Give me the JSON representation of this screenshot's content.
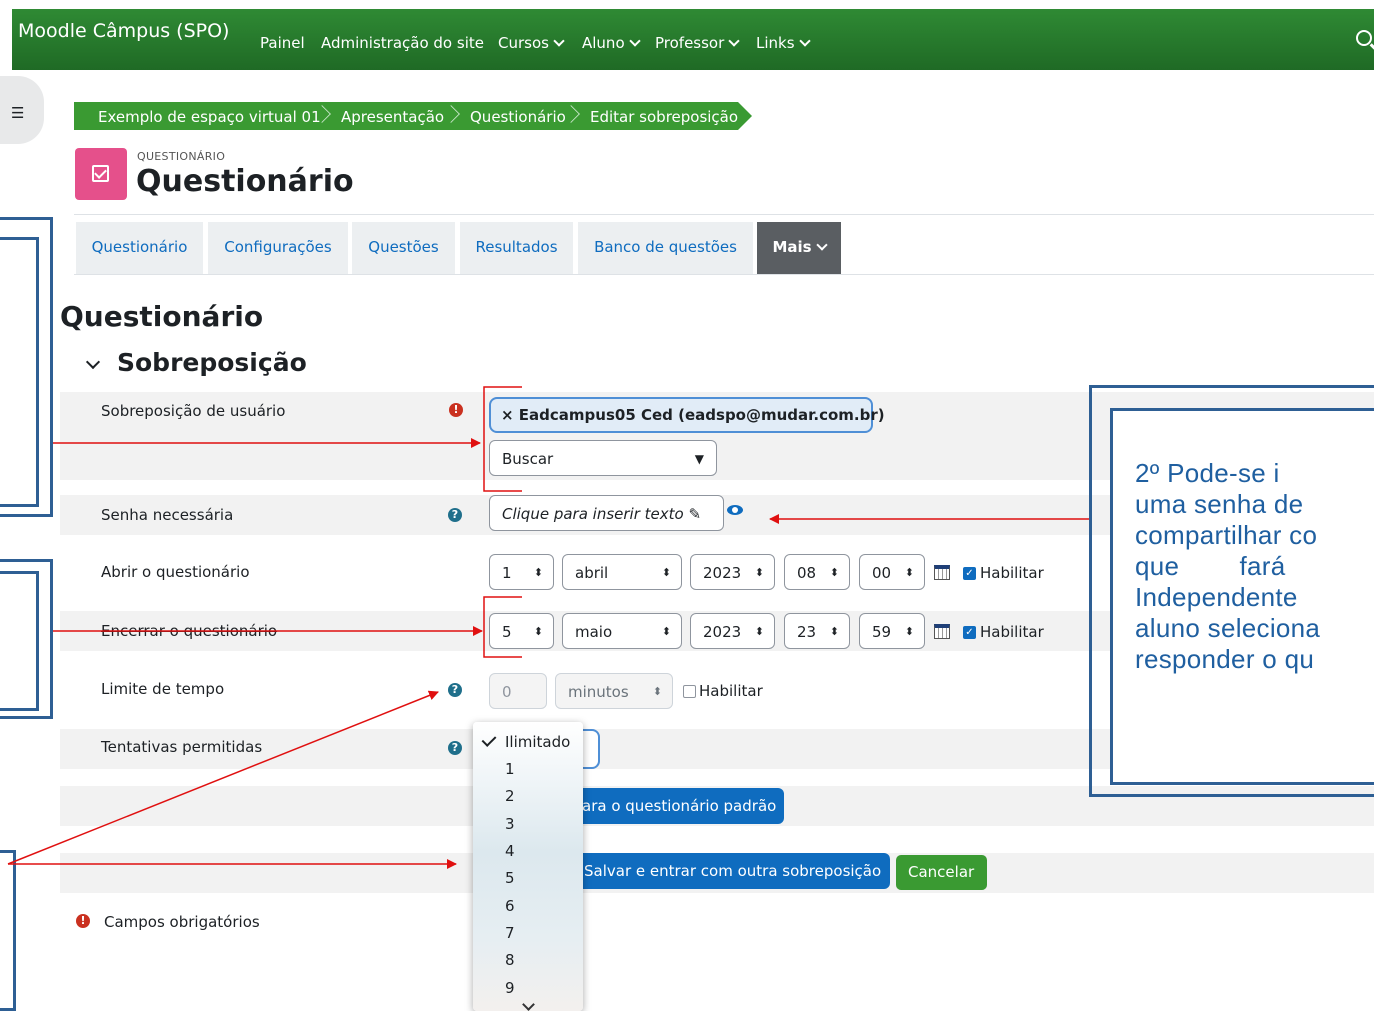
{
  "navbar": {
    "brand": "Moodle Câmpus (SPO)",
    "items": [
      {
        "label": "Painel"
      },
      {
        "label": "Administração do site"
      },
      {
        "label": "Cursos"
      },
      {
        "label": "Aluno"
      },
      {
        "label": "Professor"
      },
      {
        "label": "Links"
      }
    ]
  },
  "breadcrumb": [
    "Exemplo de espaço virtual 01",
    "Apresentação",
    "Questionário",
    "Editar sobreposição"
  ],
  "activity": {
    "type_label": "QUESTIONÁRIO",
    "title": "Questionário"
  },
  "tabs": [
    "Questionário",
    "Configurações",
    "Questões",
    "Resultados",
    "Banco de questões",
    "Mais"
  ],
  "page_heading": "Questionário",
  "section_heading": "Sobreposição",
  "form": {
    "user_override": {
      "label": "Sobreposição de usuário",
      "selected": "× Eadcampus05 Ced (eadspo@mudar.com.br)",
      "search_placeholder": "Buscar"
    },
    "password": {
      "label": "Senha necessária",
      "placeholder": "Clique para inserir texto ✎"
    },
    "open": {
      "label": "Abrir o questionário",
      "day": "1",
      "month": "abril",
      "year": "2023",
      "hour": "08",
      "minute": "00",
      "enable_label": "Habilitar",
      "enabled": true
    },
    "close": {
      "label": "Encerrar o questionário",
      "day": "5",
      "month": "maio",
      "year": "2023",
      "hour": "23",
      "minute": "59",
      "enable_label": "Habilitar",
      "enabled": true
    },
    "time_limit": {
      "label": "Limite de tempo",
      "value": "0",
      "unit": "minutos",
      "enable_label": "Habilitar",
      "enabled": false
    },
    "attempts": {
      "label": "Tentativas permitidas",
      "options": [
        "Ilimitado",
        "1",
        "2",
        "3",
        "4",
        "5",
        "6",
        "7",
        "8",
        "9"
      ],
      "selected": "Ilimitado"
    }
  },
  "buttons": {
    "revert": "ara o questionário padrão",
    "save_other": "Salvar e entrar com outra sobreposição",
    "cancel": "Cancelar"
  },
  "required_note": "Campos obrigatórios",
  "annotation": {
    "lines": [
      "2º Pode-se i",
      "uma senha de",
      "compartilhar co",
      "que        fará",
      "Independente",
      "aluno seleciona",
      "responder o qu"
    ]
  },
  "colors": {
    "navbar": "#2f8a34",
    "breadcrumb": "#3a9a32",
    "primary": "#0f6cbf",
    "annotation_border": "#2e5f94",
    "annotation_text": "#1f5fa0",
    "arrow": "#e01010"
  }
}
